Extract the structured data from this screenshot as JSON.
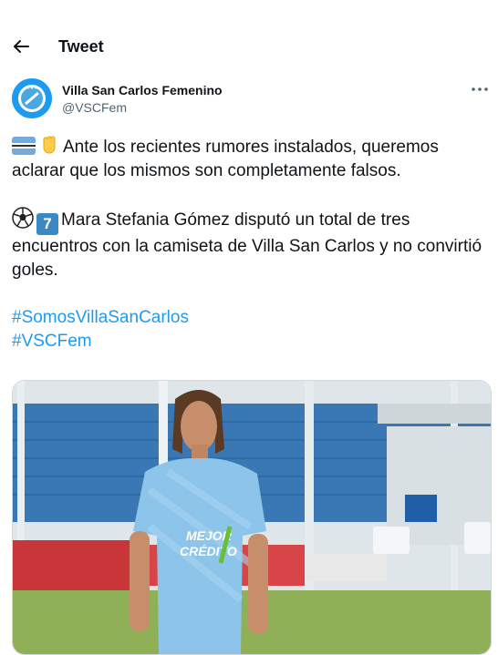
{
  "header": {
    "title": "Tweet"
  },
  "author": {
    "name": "Villa San Carlos Femenino",
    "handle": "@VSCFem"
  },
  "tweet": {
    "para1": "Ante los recientes rumores instalados, queremos aclarar que los mismos son completamente falsos.",
    "para2": "Mara Stefania Gómez disputó un total de tres encuentros con la camiseta de Villa San Carlos y no convirtió goles.",
    "emoji_digit": "7",
    "hashtags": [
      "#SomosVillaSanCarlos",
      "#VSCFem"
    ]
  },
  "media": {
    "jersey_sponsor_line1": "MEJOR",
    "jersey_sponsor_line2": "CRÉDITO"
  },
  "colors": {
    "accent": "#1d9bf0",
    "text": "#0f1419",
    "secondary": "#536471"
  }
}
